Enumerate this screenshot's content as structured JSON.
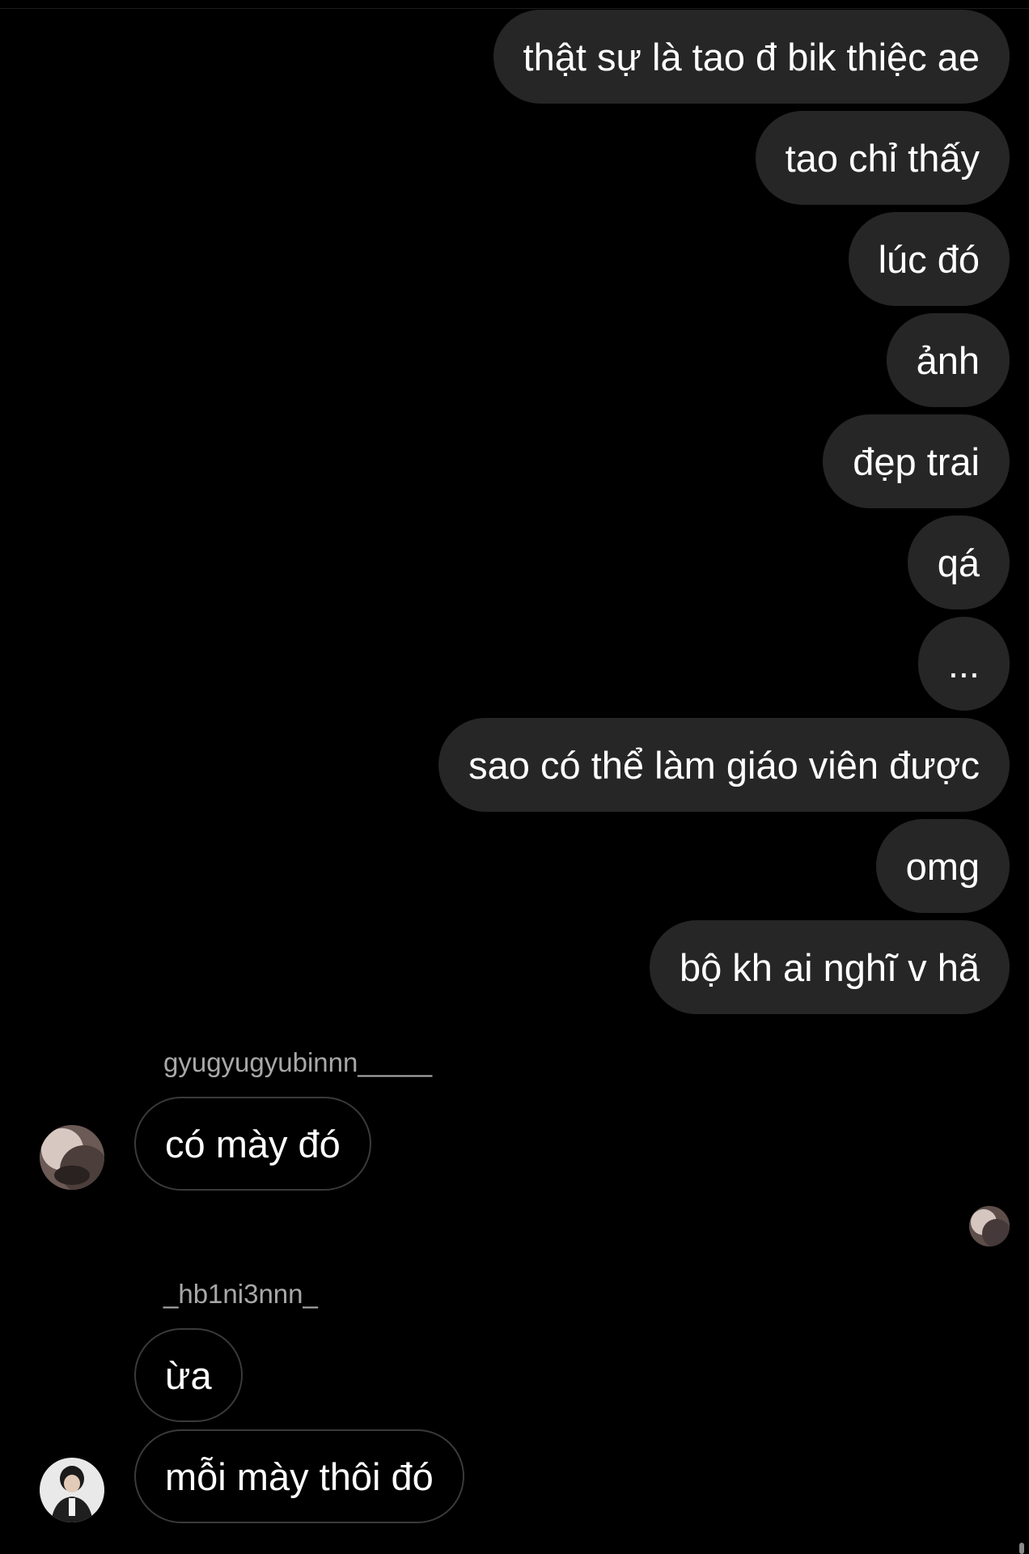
{
  "outgoing_messages": [
    "thật sự là tao đ bik thiệc ae",
    "tao chỉ thấy",
    "lúc đó",
    "ảnh",
    "đẹp trai",
    "qá",
    "...",
    "sao có thể làm giáo viên được",
    "omg",
    "bộ kh ai nghĩ v hã"
  ],
  "groups": [
    {
      "sender": "gyugyugyubinnn_____",
      "avatar_icon": "profile-photo",
      "messages": [
        "có mày đó"
      ]
    },
    {
      "sender": "_hb1ni3nnn_",
      "avatar_icon": "profile-photo",
      "messages": [
        "ừa",
        "mỗi mày thôi đó"
      ]
    }
  ],
  "read_receipt_icon": "seen-avatar",
  "colors": {
    "background": "#000000",
    "outgoing_bubble": "#262626",
    "incoming_border": "#3a3a3a",
    "sender_text": "#a8a8a8"
  }
}
